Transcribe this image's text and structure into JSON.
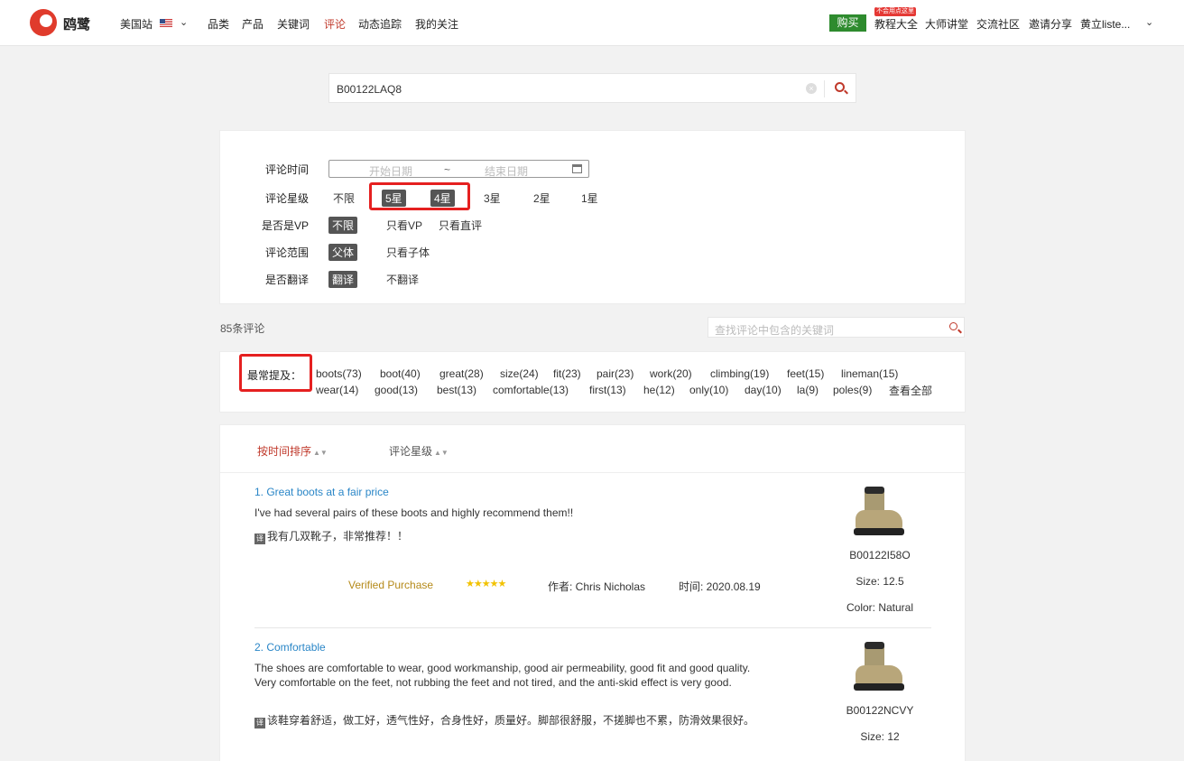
{
  "nav": {
    "logo_text": "鸥鹭",
    "site": "美国站",
    "items": [
      "品类",
      "产品",
      "关键词",
      "评论",
      "动态追踪",
      "我的关注"
    ],
    "active_index": 3,
    "buy": "购买",
    "badge": "不会用点这里",
    "right_items": [
      "教程大全",
      "大师讲堂",
      "交流社区",
      "邀请分享"
    ],
    "user": "黄立liste..."
  },
  "search": {
    "value": "B00122LAQ8"
  },
  "filters": {
    "time_label": "评论时间",
    "start_placeholder": "开始日期",
    "sep": "~",
    "end_placeholder": "结束日期",
    "star_label": "评论星级",
    "star_options": [
      "不限",
      "5星",
      "4星",
      "3星",
      "2星",
      "1星"
    ],
    "vp_label": "是否是VP",
    "vp_options": [
      "不限",
      "只看VP",
      "只看直评"
    ],
    "scope_label": "评论范围",
    "scope_options": [
      "父体",
      "只看子体"
    ],
    "translate_label": "是否翻译",
    "translate_options": [
      "翻译",
      "不翻译"
    ]
  },
  "count_text": "85条评论",
  "keyword_placeholder": "查找评论中包含的关键词",
  "mentions": {
    "label": "最常提及：",
    "row1": [
      "boots(73)",
      "boot(40)",
      "great(28)",
      "size(24)",
      "fit(23)",
      "pair(23)",
      "work(20)",
      "climbing(19)",
      "feet(15)",
      "lineman(15)"
    ],
    "row2": [
      "wear(14)",
      "good(13)",
      "best(13)",
      "comfortable(13)",
      "first(13)",
      "he(12)",
      "only(10)",
      "day(10)",
      "la(9)",
      "poles(9)"
    ],
    "view_all": "查看全部"
  },
  "sort": {
    "by_time": "按时间排序",
    "by_rating": "评论星级"
  },
  "reviews": [
    {
      "title": "1. Great boots at a fair price",
      "body": "I've had several pairs of these boots and highly recommend them!!",
      "translation": "我有几双靴子，非常推荐！！",
      "verified": "Verified Purchase",
      "stars": "★★★★★",
      "author": "作者: Chris Nicholas",
      "time": "时间: 2020.08.19",
      "asin": "B00122I58O",
      "size": "Size:  12.5",
      "color": "Color:  Natural"
    },
    {
      "title": "2. Comfortable",
      "body": "The shoes are comfortable to wear, good workmanship, good air permeability, good fit and good quality. Very comfortable on the feet, not rubbing the feet and not tired, and the anti-skid effect is very good.",
      "translation": "该鞋穿着舒适，做工好，透气性好，合身性好，质量好。脚部很舒服，不搓脚也不累，防滑效果很好。",
      "asin": "B00122NCVY",
      "size": "Size:  12"
    }
  ],
  "translate_icon_text": "译",
  "colors": {
    "accent": "#c0392b",
    "link": "#2a86c7",
    "highlight": "#e52020",
    "buy": "#2e8b2e"
  }
}
